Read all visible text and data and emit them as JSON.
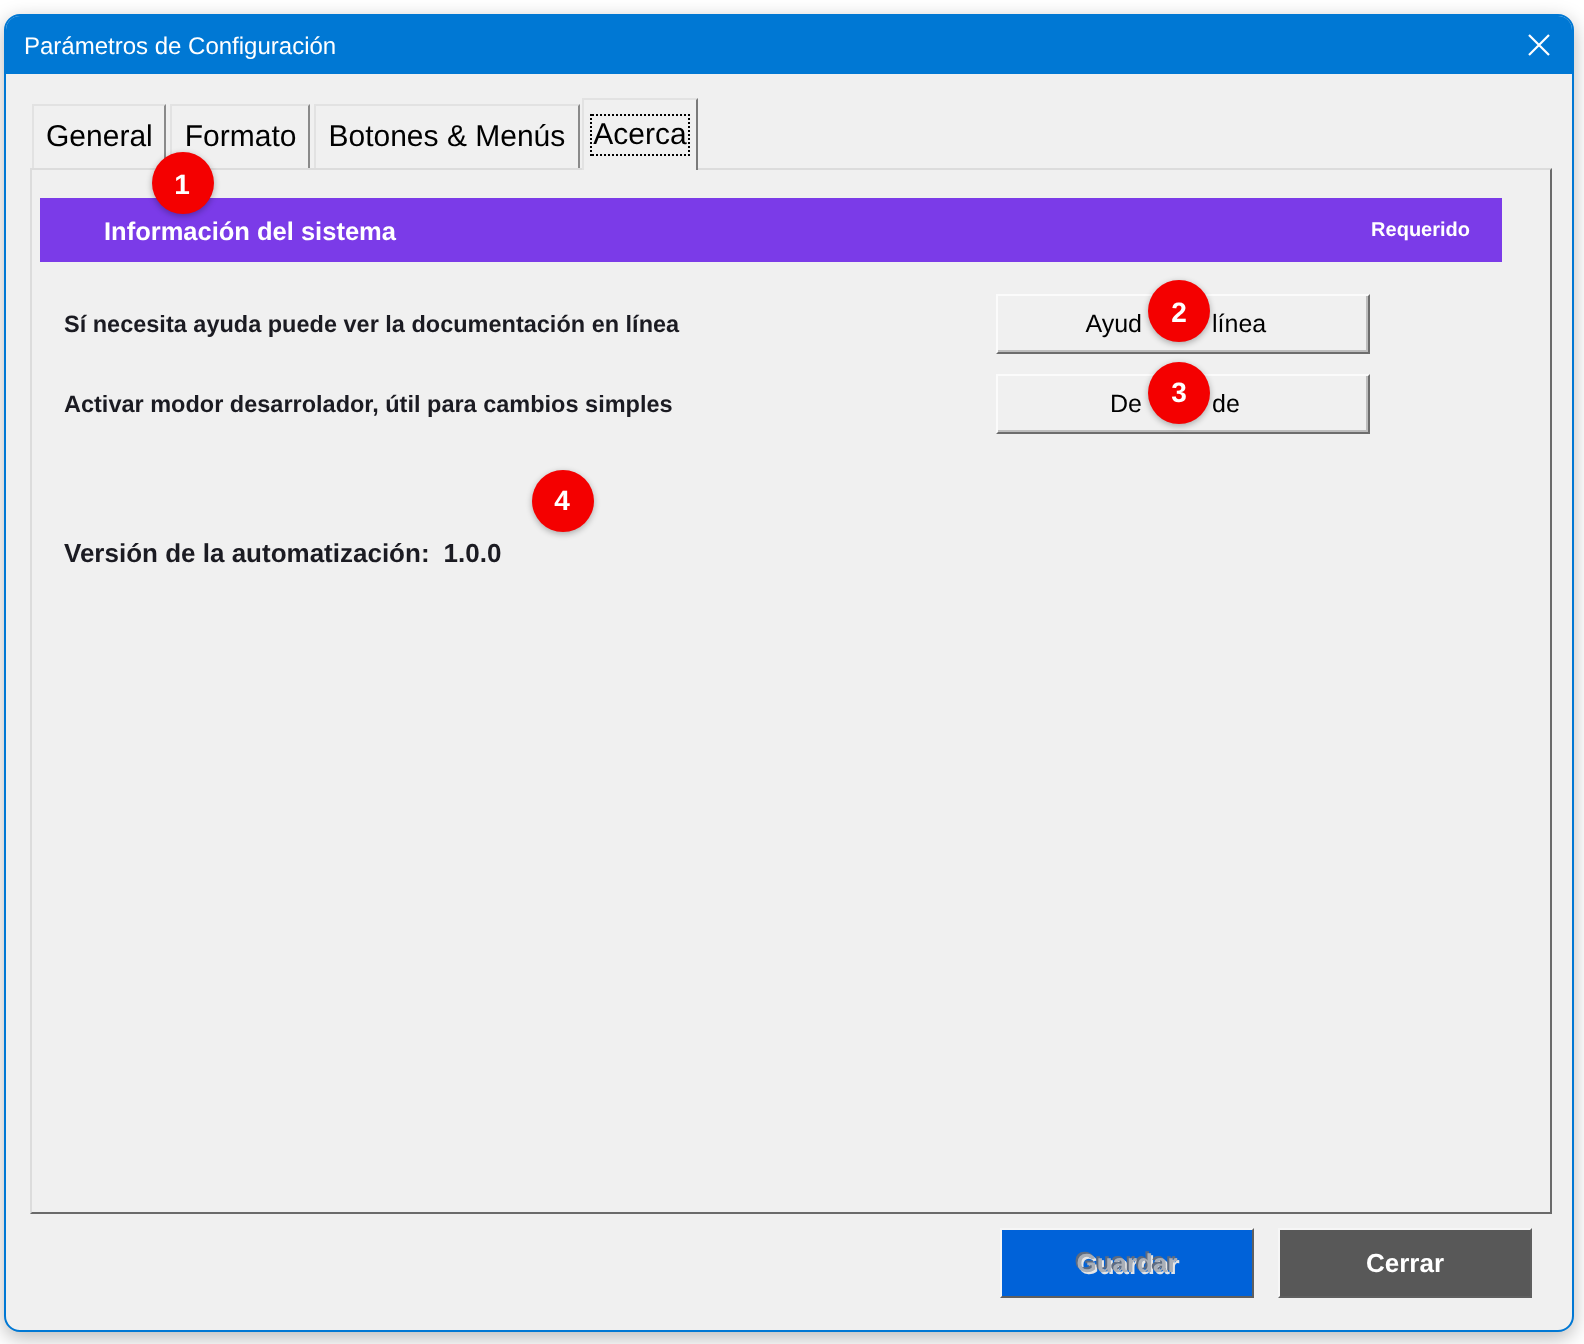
{
  "window": {
    "title": "Parámetros de Configuración"
  },
  "tabs": [
    {
      "label": "General",
      "selected": false
    },
    {
      "label": "Formato",
      "selected": false
    },
    {
      "label": "Botones & Menús",
      "selected": false
    },
    {
      "label": "Acerca",
      "selected": true
    }
  ],
  "section_header": {
    "title": "Información del sistema",
    "badge": "Requerido"
  },
  "options": [
    {
      "description": "Sí necesita ayuda puede ver la documentación en línea",
      "button_visible_parts": [
        "Ayud",
        "línea"
      ]
    },
    {
      "description": "Activar modor desarrolador, útil para cambios simples",
      "button_visible_parts": [
        "De",
        "de"
      ]
    }
  ],
  "version": {
    "label": "Versión de la automatización:",
    "value": "1.0.0"
  },
  "footer_buttons": [
    {
      "label": "Guardar",
      "kind": "primary",
      "disabled": true
    },
    {
      "label": "Cerrar",
      "kind": "secondary",
      "disabled": false
    }
  ],
  "annotations": [
    {
      "label": "1"
    },
    {
      "label": "2"
    },
    {
      "label": "3"
    },
    {
      "label": "4"
    }
  ]
}
